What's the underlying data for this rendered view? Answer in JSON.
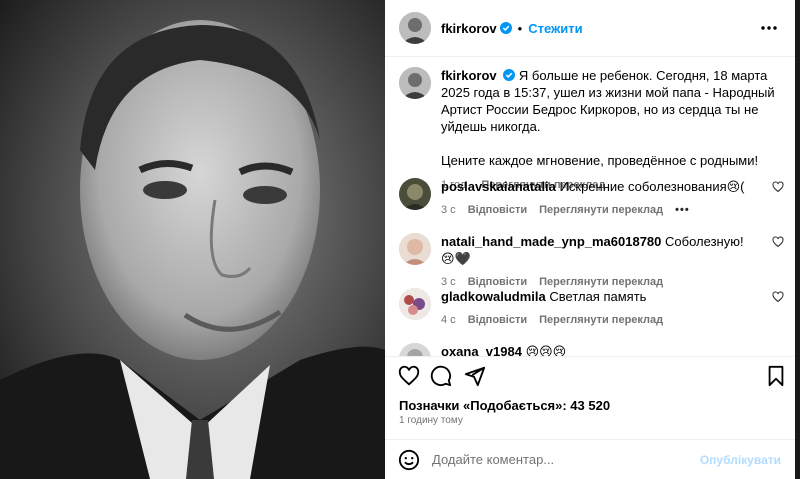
{
  "post": {
    "author": "fkirkorov",
    "dot": "•",
    "follow_label": "Стежити",
    "caption_line": "Я больше не ребенок. Сегодня, 18 марта 2025 года в 15:37, ушел из жизни мой папа - Народный Артист России Бедрос Киркоров, но из сердца ты не уйдешь никогда.",
    "caption_line2": "Цените каждое мгновение, проведённое с родными!",
    "caption_time": "1 год",
    "see_translation": "Переглянути переклад"
  },
  "comments": [
    {
      "user": "poslavskaianatalia",
      "text": "Искренние соболезнования😢(",
      "time": "3 с",
      "reply": "Відповісти",
      "translate": "Переглянути переклад",
      "more": "•••"
    },
    {
      "user": "natali_hand_made_ynp_ma6018780",
      "text": "Соболезную!😢🖤",
      "time": "3 с",
      "reply": "Відповісти",
      "translate": "Переглянути переклад"
    },
    {
      "user": "gladkowaludmila",
      "text": "Светлая память",
      "time": "4 с",
      "reply": "Відповісти",
      "translate": "Переглянути переклад"
    },
    {
      "user": "oxana_v1984",
      "text": "😢😢😢"
    }
  ],
  "likes": {
    "label": "Позначки «Подобається»: 43 520"
  },
  "posted": "1 годину тому",
  "composer": {
    "placeholder": "Додайте коментар...",
    "post_label": "Опублікувати"
  },
  "icons": {
    "verified": "verified-badge-icon",
    "more": "more-horizontal-icon",
    "like": "heart-icon",
    "comment": "comment-icon",
    "share": "send-icon",
    "save": "bookmark-icon",
    "emoji": "emoji-icon"
  },
  "colors": {
    "accent": "#0095f6",
    "secondary_text": "#737373",
    "post_disabled": "#b3dbff"
  }
}
